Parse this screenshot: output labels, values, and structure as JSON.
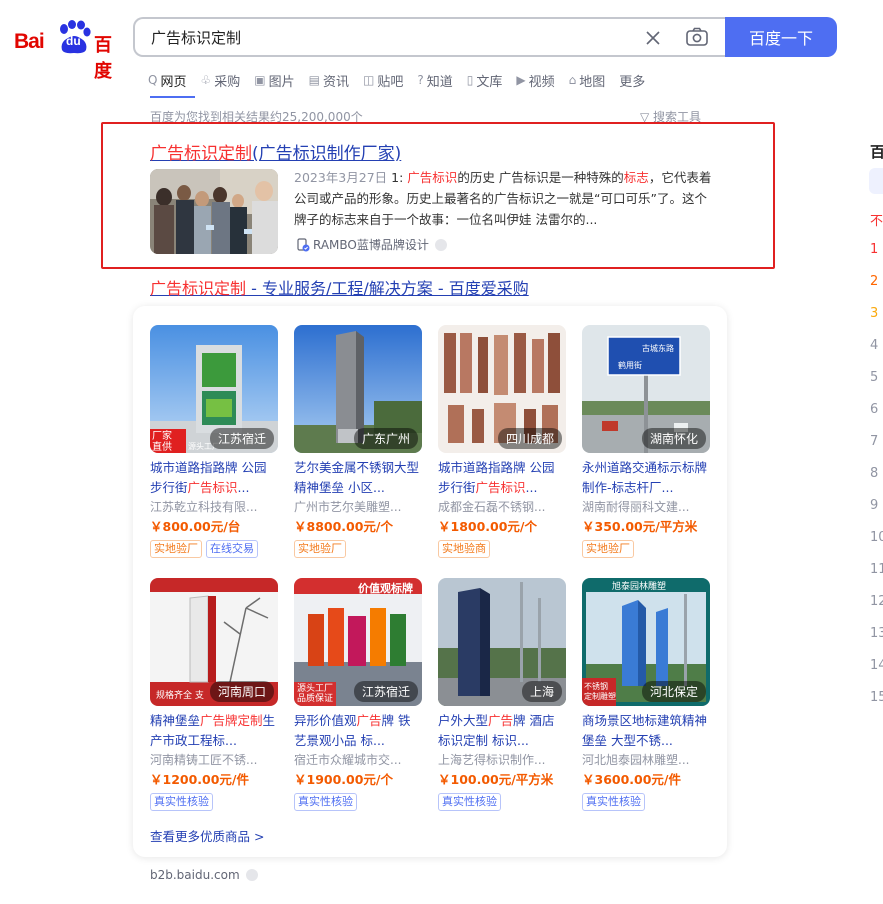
{
  "logo": {
    "bai": "Bai",
    "du": "du",
    "cn": "百度"
  },
  "search": {
    "query": "广告标识定制",
    "button": "百度一下"
  },
  "tabs": [
    {
      "icon": "Q",
      "label": "网页"
    },
    {
      "icon": "♧",
      "label": "采购"
    },
    {
      "icon": "▣",
      "label": "图片"
    },
    {
      "icon": "▤",
      "label": "资讯"
    },
    {
      "icon": "◫",
      "label": "贴吧"
    },
    {
      "icon": "?",
      "label": "知道"
    },
    {
      "icon": "▯",
      "label": "文库"
    },
    {
      "icon": "▶",
      "label": "视频"
    },
    {
      "icon": "⌂",
      "label": "地图"
    },
    {
      "icon": "",
      "label": "更多"
    }
  ],
  "result_count": "百度为您找到相关结果约25,200,000个",
  "search_tools": "搜索工具",
  "result1": {
    "title_em": "广告标识定制",
    "title_rest": "(广告标识制作厂家)",
    "date": "2023年3月27日",
    "a1": " 1: ",
    "a2_em": "广告标识",
    "a3": "的历史 广告标识是一种特殊的",
    "a4_em": "标志",
    "a5": "，它代表着公司或产品的形象。历史上最著名的广告标识之一就是“可口可乐”了。这个牌子的标志来自于一个故事：一位名叫伊娃 法雷尔的...",
    "source": "RAMBO蓝博品牌设计"
  },
  "result2": {
    "title_em": "广告标识定制",
    "title_rest": " - 专业服务/工程/解决方案 - 百度爱采购"
  },
  "products": [
    {
      "loc": "江苏宿迁",
      "t1": "城市道路指路牌 公园步行街",
      "t_em": "广告标识",
      "t2": "...",
      "seller": "江苏乾立科技有限...",
      "price": "￥800.00元/台",
      "tags": [
        {
          "text": "实地验厂",
          "style": "orange"
        },
        {
          "text": "在线交易",
          "style": "blue"
        }
      ],
      "badge": "厂家\n直供",
      "sub": "源头工厂"
    },
    {
      "loc": "广东广州",
      "t1": "艺尔美金属不锈钢大型精神堡垒 小区...",
      "t_em": "",
      "t2": "",
      "seller": "广州市艺尔美雕塑...",
      "price": "￥8800.00元/个",
      "tags": [
        {
          "text": "实地验厂",
          "style": "orange"
        }
      ]
    },
    {
      "loc": "四川成都",
      "t1": "城市道路指路牌 公园步行街",
      "t_em": "广告标识",
      "t2": "...",
      "seller": "成都金石磊不锈钢...",
      "price": "￥1800.00元/个",
      "tags": [
        {
          "text": "实地验商",
          "style": "orange"
        }
      ]
    },
    {
      "loc": "湖南怀化",
      "t1": "永州道路交通标示标牌制作-标志杆厂...",
      "t_em": "",
      "t2": "",
      "seller": "湖南耐得丽科文建...",
      "price": "￥350.00元/平方米",
      "tags": [
        {
          "text": "实地验厂",
          "style": "orange"
        }
      ],
      "sign1": "古城东路",
      "sign2": "鹤用街"
    },
    {
      "loc": "河南周口",
      "t1": "精神堡垒",
      "t_em": "广告牌定制",
      "t2": "生产市政工程标...",
      "seller": "河南精铸工匠不锈...",
      "price": "￥1200.00元/件",
      "tags": [
        {
          "text": "真实性核验",
          "style": "blue"
        }
      ],
      "badge": "规格齐全 支"
    },
    {
      "loc": "江苏宿迁",
      "t1": "异形价值观",
      "t_em": "广告",
      "t2": "牌 铁艺景观小品 标...",
      "seller": "宿迁市众耀城市交...",
      "price": "￥1900.00元/个",
      "tags": [
        {
          "text": "真实性核验",
          "style": "blue"
        }
      ],
      "badge": "源头工厂\n品质保证",
      "banner": "价值观标牌"
    },
    {
      "loc": "上海",
      "t1": "户外大型",
      "t_em": "广告",
      "t2": "牌 酒店标识定制 标识...",
      "seller": "上海艺得标识制作...",
      "price": "￥100.00元/平方米",
      "tags": [
        {
          "text": "真实性核验",
          "style": "blue"
        }
      ]
    },
    {
      "loc": "河北保定",
      "t1": "商场景区地标建筑精神堡垒 大型不锈...",
      "t_em": "",
      "t2": "",
      "seller": "河北旭泰园林雕塑...",
      "price": "￥3600.00元/件",
      "tags": [
        {
          "text": "真实性核验",
          "style": "blue"
        }
      ],
      "badge": "不锈钢\n定制雕塑",
      "banner": "旭泰园林雕塑"
    }
  ],
  "more_products": "查看更多优质商品 >",
  "source_url": "b2b.baidu.com",
  "hot": {
    "title": "百",
    "red": "不",
    "nums": [
      "1",
      "2",
      "3",
      "4",
      "5",
      "6",
      "7",
      "8",
      "9",
      "10",
      "11",
      "12",
      "13",
      "14",
      "15"
    ],
    "num_colors": [
      "#f73131",
      "#ff6600",
      "#faa90e"
    ]
  },
  "colors": {
    "brand_red": "#e10601",
    "button_blue": "#4e6ef2",
    "link_blue": "#2440b3",
    "highlight_red": "#f73131",
    "price_orange": "#f35a00"
  }
}
